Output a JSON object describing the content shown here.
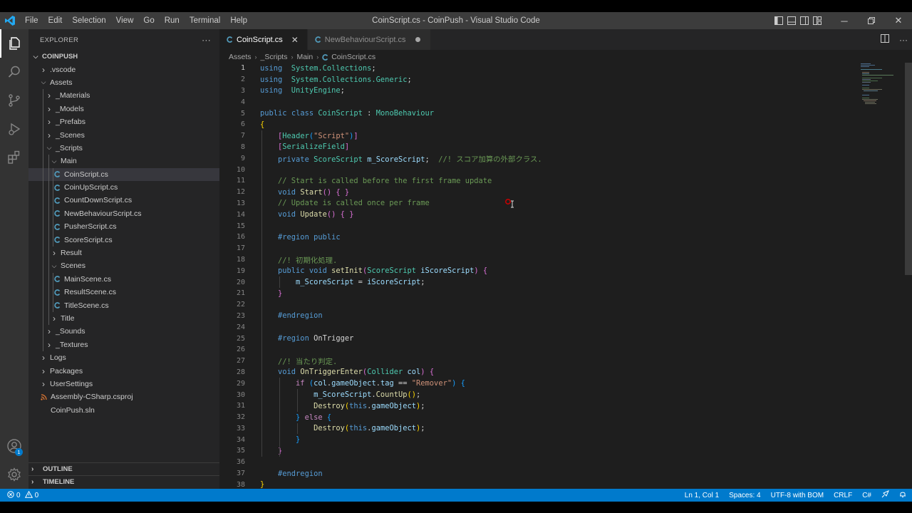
{
  "window": {
    "title": "CoinScript.cs - CoinPush - Visual Studio Code",
    "menu": [
      "File",
      "Edit",
      "Selection",
      "View",
      "Go",
      "Run",
      "Terminal",
      "Help"
    ]
  },
  "activity_bar": {
    "icons": [
      "explorer-icon",
      "search-icon",
      "source-control-icon",
      "run-debug-icon",
      "extensions-icon"
    ],
    "bottom_icons": [
      "accounts-icon",
      "settings-gear-icon"
    ],
    "accounts_badge": "1"
  },
  "sidebar": {
    "header": "EXPLORER",
    "more": "···",
    "root": "COINPUSH",
    "items": [
      {
        "label": ".vscode",
        "kind": "folder",
        "open": false,
        "depth": 1
      },
      {
        "label": "Assets",
        "kind": "folder",
        "open": true,
        "depth": 1
      },
      {
        "label": "_Materials",
        "kind": "folder",
        "open": false,
        "depth": 2
      },
      {
        "label": "_Models",
        "kind": "folder",
        "open": false,
        "depth": 2
      },
      {
        "label": "_Prefabs",
        "kind": "folder",
        "open": false,
        "depth": 2
      },
      {
        "label": "_Scenes",
        "kind": "folder",
        "open": false,
        "depth": 2
      },
      {
        "label": "_Scripts",
        "kind": "folder",
        "open": true,
        "depth": 2
      },
      {
        "label": "Main",
        "kind": "folder",
        "open": true,
        "depth": 3
      },
      {
        "label": "CoinScript.cs",
        "kind": "cs",
        "depth": 4,
        "selected": true
      },
      {
        "label": "CoinUpScript.cs",
        "kind": "cs",
        "depth": 4
      },
      {
        "label": "CountDownScript.cs",
        "kind": "cs",
        "depth": 4
      },
      {
        "label": "NewBehaviourScript.cs",
        "kind": "cs",
        "depth": 4
      },
      {
        "label": "PusherScript.cs",
        "kind": "cs",
        "depth": 4
      },
      {
        "label": "ScoreScript.cs",
        "kind": "cs",
        "depth": 4
      },
      {
        "label": "Result",
        "kind": "folder",
        "open": false,
        "depth": 3
      },
      {
        "label": "Scenes",
        "kind": "folder",
        "open": true,
        "depth": 3
      },
      {
        "label": "MainScene.cs",
        "kind": "cs",
        "depth": 4
      },
      {
        "label": "ResultScene.cs",
        "kind": "cs",
        "depth": 4
      },
      {
        "label": "TitleScene.cs",
        "kind": "cs",
        "depth": 4
      },
      {
        "label": "Title",
        "kind": "folder",
        "open": false,
        "depth": 3
      },
      {
        "label": "_Sounds",
        "kind": "folder",
        "open": false,
        "depth": 2
      },
      {
        "label": "_Textures",
        "kind": "folder",
        "open": false,
        "depth": 2
      },
      {
        "label": "Logs",
        "kind": "folder",
        "open": false,
        "depth": 1
      },
      {
        "label": "Packages",
        "kind": "folder",
        "open": false,
        "depth": 1
      },
      {
        "label": "UserSettings",
        "kind": "folder",
        "open": false,
        "depth": 1
      },
      {
        "label": "Assembly-CSharp.csproj",
        "kind": "rss",
        "depth": 1
      },
      {
        "label": "CoinPush.sln",
        "kind": "sln",
        "depth": 1
      }
    ],
    "outline": "OUTLINE",
    "timeline": "TIMELINE"
  },
  "tabs": [
    {
      "label": "CoinScript.cs",
      "active": true,
      "close": "✕"
    },
    {
      "label": "NewBehaviourScript.cs",
      "active": false,
      "dirty": true
    }
  ],
  "breadcrumbs": [
    "Assets",
    "_Scripts",
    "Main",
    "CoinScript.cs"
  ],
  "code": {
    "current_line": 1,
    "lines": [
      {
        "n": "1",
        "tokens": [
          [
            "kw",
            "using"
          ],
          [
            "",
            "  "
          ],
          [
            "ns",
            "System.Collections"
          ],
          [
            "",
            ";"
          ]
        ]
      },
      {
        "n": "2",
        "tokens": [
          [
            "kw",
            "using"
          ],
          [
            "",
            "  "
          ],
          [
            "ns",
            "System.Collections.Generic"
          ],
          [
            "",
            ";"
          ]
        ]
      },
      {
        "n": "3",
        "tokens": [
          [
            "kw",
            "using"
          ],
          [
            "",
            "  "
          ],
          [
            "ns",
            "UnityEngine"
          ],
          [
            "",
            ";"
          ]
        ]
      },
      {
        "n": "4",
        "tokens": []
      },
      {
        "n": "5",
        "tokens": [
          [
            "kw",
            "public"
          ],
          [
            "",
            " "
          ],
          [
            "kw",
            "class"
          ],
          [
            "",
            " "
          ],
          [
            "ty",
            "CoinScript"
          ],
          [
            "",
            " : "
          ],
          [
            "ty",
            "MonoBehaviour"
          ]
        ]
      },
      {
        "n": "6",
        "tokens": [
          [
            "b1",
            "{"
          ]
        ]
      },
      {
        "n": "7",
        "tokens": [
          [
            "",
            "    "
          ],
          [
            "b2",
            "["
          ],
          [
            "ty",
            "Header"
          ],
          [
            "b3",
            "("
          ],
          [
            "st",
            "\"Script\""
          ],
          [
            "b3",
            ")"
          ],
          [
            "b2",
            "]"
          ]
        ]
      },
      {
        "n": "8",
        "tokens": [
          [
            "",
            "    "
          ],
          [
            "b2",
            "["
          ],
          [
            "ty",
            "SerializeField"
          ],
          [
            "b2",
            "]"
          ]
        ]
      },
      {
        "n": "9",
        "tokens": [
          [
            "",
            "    "
          ],
          [
            "kw",
            "private"
          ],
          [
            "",
            " "
          ],
          [
            "ty",
            "ScoreScript"
          ],
          [
            "",
            " "
          ],
          [
            "vr",
            "m_ScoreScript"
          ],
          [
            "",
            ";  "
          ],
          [
            "cm",
            "//! スコア加算の外部クラス."
          ]
        ]
      },
      {
        "n": "10",
        "tokens": []
      },
      {
        "n": "11",
        "tokens": [
          [
            "",
            "    "
          ],
          [
            "cm",
            "// Start is called before the first frame update"
          ]
        ]
      },
      {
        "n": "12",
        "tokens": [
          [
            "",
            "    "
          ],
          [
            "kw",
            "void"
          ],
          [
            "",
            " "
          ],
          [
            "fn",
            "Start"
          ],
          [
            "b2",
            "()"
          ],
          [
            "",
            " "
          ],
          [
            "b2",
            "{"
          ],
          [
            "",
            " "
          ],
          [
            "b2",
            "}"
          ]
        ]
      },
      {
        "n": "13",
        "tokens": [
          [
            "",
            "    "
          ],
          [
            "cm",
            "// Update is called once per frame"
          ]
        ]
      },
      {
        "n": "14",
        "tokens": [
          [
            "",
            "    "
          ],
          [
            "kw",
            "void"
          ],
          [
            "",
            " "
          ],
          [
            "fn",
            "Update"
          ],
          [
            "b2",
            "()"
          ],
          [
            "",
            " "
          ],
          [
            "b2",
            "{"
          ],
          [
            "",
            " "
          ],
          [
            "b2",
            "}"
          ]
        ]
      },
      {
        "n": "15",
        "tokens": []
      },
      {
        "n": "16",
        "tokens": [
          [
            "",
            "    "
          ],
          [
            "kw",
            "#region"
          ],
          [
            "",
            " "
          ],
          [
            "kw",
            "public"
          ]
        ]
      },
      {
        "n": "17",
        "tokens": []
      },
      {
        "n": "18",
        "tokens": [
          [
            "",
            "    "
          ],
          [
            "cm",
            "//! 初期化処理."
          ]
        ]
      },
      {
        "n": "19",
        "tokens": [
          [
            "",
            "    "
          ],
          [
            "kw",
            "public"
          ],
          [
            "",
            " "
          ],
          [
            "kw",
            "void"
          ],
          [
            "",
            " "
          ],
          [
            "fn",
            "setInit"
          ],
          [
            "b2",
            "("
          ],
          [
            "ty",
            "ScoreScript"
          ],
          [
            "",
            " "
          ],
          [
            "vr",
            "iScoreScript"
          ],
          [
            "b2",
            ")"
          ],
          [
            "",
            " "
          ],
          [
            "b2",
            "{"
          ]
        ]
      },
      {
        "n": "20",
        "tokens": [
          [
            "",
            "        "
          ],
          [
            "vr",
            "m_ScoreScript"
          ],
          [
            "",
            " = "
          ],
          [
            "vr",
            "iScoreScript"
          ],
          [
            "",
            ";"
          ]
        ]
      },
      {
        "n": "21",
        "tokens": [
          [
            "",
            "    "
          ],
          [
            "b2",
            "}"
          ]
        ]
      },
      {
        "n": "22",
        "tokens": []
      },
      {
        "n": "23",
        "tokens": [
          [
            "",
            "    "
          ],
          [
            "kw",
            "#endregion"
          ]
        ]
      },
      {
        "n": "24",
        "tokens": []
      },
      {
        "n": "25",
        "tokens": [
          [
            "",
            "    "
          ],
          [
            "kw",
            "#region"
          ],
          [
            "",
            " "
          ],
          [
            "",
            "OnTrigger"
          ]
        ]
      },
      {
        "n": "26",
        "tokens": []
      },
      {
        "n": "27",
        "tokens": [
          [
            "",
            "    "
          ],
          [
            "cm",
            "//! 当たり判定."
          ]
        ]
      },
      {
        "n": "28",
        "tokens": [
          [
            "",
            "    "
          ],
          [
            "kw",
            "void"
          ],
          [
            "",
            " "
          ],
          [
            "fn",
            "OnTriggerEnter"
          ],
          [
            "b2",
            "("
          ],
          [
            "ty",
            "Collider"
          ],
          [
            "",
            " "
          ],
          [
            "vr",
            "col"
          ],
          [
            "b2",
            ")"
          ],
          [
            "",
            " "
          ],
          [
            "b2",
            "{"
          ]
        ]
      },
      {
        "n": "29",
        "tokens": [
          [
            "",
            "        "
          ],
          [
            "ctl",
            "if"
          ],
          [
            "",
            " "
          ],
          [
            "b3",
            "("
          ],
          [
            "vr",
            "col"
          ],
          [
            "",
            "."
          ],
          [
            "vr",
            "gameObject"
          ],
          [
            "",
            "."
          ],
          [
            "vr",
            "tag"
          ],
          [
            "",
            " == "
          ],
          [
            "st",
            "\"Remover\""
          ],
          [
            "b3",
            ")"
          ],
          [
            "",
            " "
          ],
          [
            "b3",
            "{"
          ]
        ]
      },
      {
        "n": "30",
        "tokens": [
          [
            "",
            "            "
          ],
          [
            "vr",
            "m_ScoreScript"
          ],
          [
            "",
            "."
          ],
          [
            "fn",
            "CountUp"
          ],
          [
            "b1",
            "()"
          ],
          [
            "",
            ";"
          ]
        ]
      },
      {
        "n": "31",
        "tokens": [
          [
            "",
            "            "
          ],
          [
            "fn",
            "Destroy"
          ],
          [
            "b1",
            "("
          ],
          [
            "kw",
            "this"
          ],
          [
            "",
            "."
          ],
          [
            "vr",
            "gameObject"
          ],
          [
            "b1",
            ")"
          ],
          [
            "",
            ";"
          ]
        ]
      },
      {
        "n": "32",
        "tokens": [
          [
            "",
            "        "
          ],
          [
            "b3",
            "}"
          ],
          [
            "",
            " "
          ],
          [
            "ctl",
            "else"
          ],
          [
            "",
            " "
          ],
          [
            "b3",
            "{"
          ]
        ]
      },
      {
        "n": "33",
        "tokens": [
          [
            "",
            "            "
          ],
          [
            "fn",
            "Destroy"
          ],
          [
            "b1",
            "("
          ],
          [
            "kw",
            "this"
          ],
          [
            "",
            "."
          ],
          [
            "vr",
            "gameObject"
          ],
          [
            "b1",
            ")"
          ],
          [
            "",
            ";"
          ]
        ]
      },
      {
        "n": "34",
        "tokens": [
          [
            "",
            "        "
          ],
          [
            "b3",
            "}"
          ]
        ]
      },
      {
        "n": "35",
        "tokens": [
          [
            "",
            "    "
          ],
          [
            "b2",
            "}"
          ]
        ]
      },
      {
        "n": "36",
        "tokens": []
      },
      {
        "n": "37",
        "tokens": [
          [
            "",
            "    "
          ],
          [
            "kw",
            "#endregion"
          ]
        ]
      },
      {
        "n": "38",
        "tokens": [
          [
            "b1",
            "}"
          ]
        ]
      }
    ]
  },
  "statusbar": {
    "errors": "0",
    "warnings": "0",
    "position": "Ln 1, Col 1",
    "spaces": "Spaces: 4",
    "encoding": "UTF-8 with BOM",
    "eol": "CRLF",
    "language": "C#"
  },
  "colors": {
    "accent": "#007acc",
    "titlebar": "#3c3c3c",
    "sidebar": "#252526",
    "editor": "#1e1e1e",
    "cs_icon": "#519aba",
    "vscode_logo": "#23a9f2"
  }
}
